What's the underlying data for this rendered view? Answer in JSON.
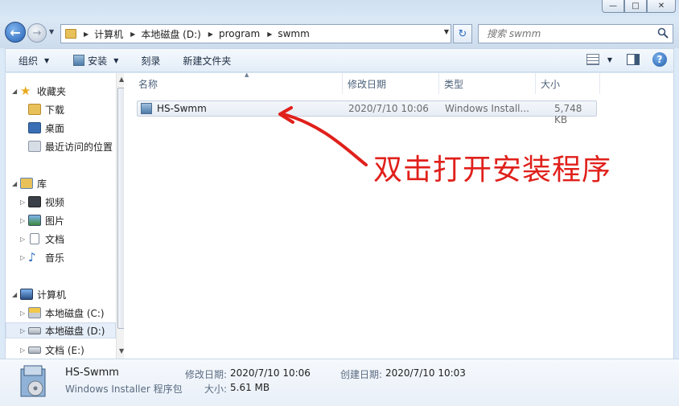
{
  "window": {
    "minimize_label": "—",
    "maximize_label": "□",
    "close_label": "✕"
  },
  "address": {
    "crumbs": [
      "计算机",
      "本地磁盘 (D:)",
      "program",
      "swmm"
    ]
  },
  "search": {
    "placeholder": "搜索 swmm"
  },
  "toolbar": {
    "organize": "组织",
    "install": "安装",
    "burn": "刻录",
    "new_folder": "新建文件夹"
  },
  "nav": {
    "favorites": "收藏夹",
    "downloads": "下载",
    "desktop": "桌面",
    "recent": "最近访问的位置",
    "libraries": "库",
    "videos": "视频",
    "pictures": "图片",
    "documents": "文档",
    "music": "音乐",
    "computer": "计算机",
    "drive_c": "本地磁盘 (C:)",
    "drive_d": "本地磁盘 (D:)",
    "drive_e": "文档 (E:)"
  },
  "columns": {
    "name": "名称",
    "modified": "修改日期",
    "type": "类型",
    "size": "大小"
  },
  "files": [
    {
      "name": "HS-Swmm",
      "modified": "2020/7/10 10:06",
      "type": "Windows Install...",
      "size": "5,748 KB"
    }
  ],
  "annotation": {
    "text": "双击打开安装程序",
    "color": "#e0201b"
  },
  "details": {
    "name": "HS-Swmm",
    "type": "Windows Installer 程序包",
    "modified_label": "修改日期:",
    "modified_value": "2020/7/10 10:06",
    "created_label": "创建日期:",
    "created_value": "2020/7/10 10:03",
    "size_label": "大小:",
    "size_value": "5.61 MB"
  }
}
